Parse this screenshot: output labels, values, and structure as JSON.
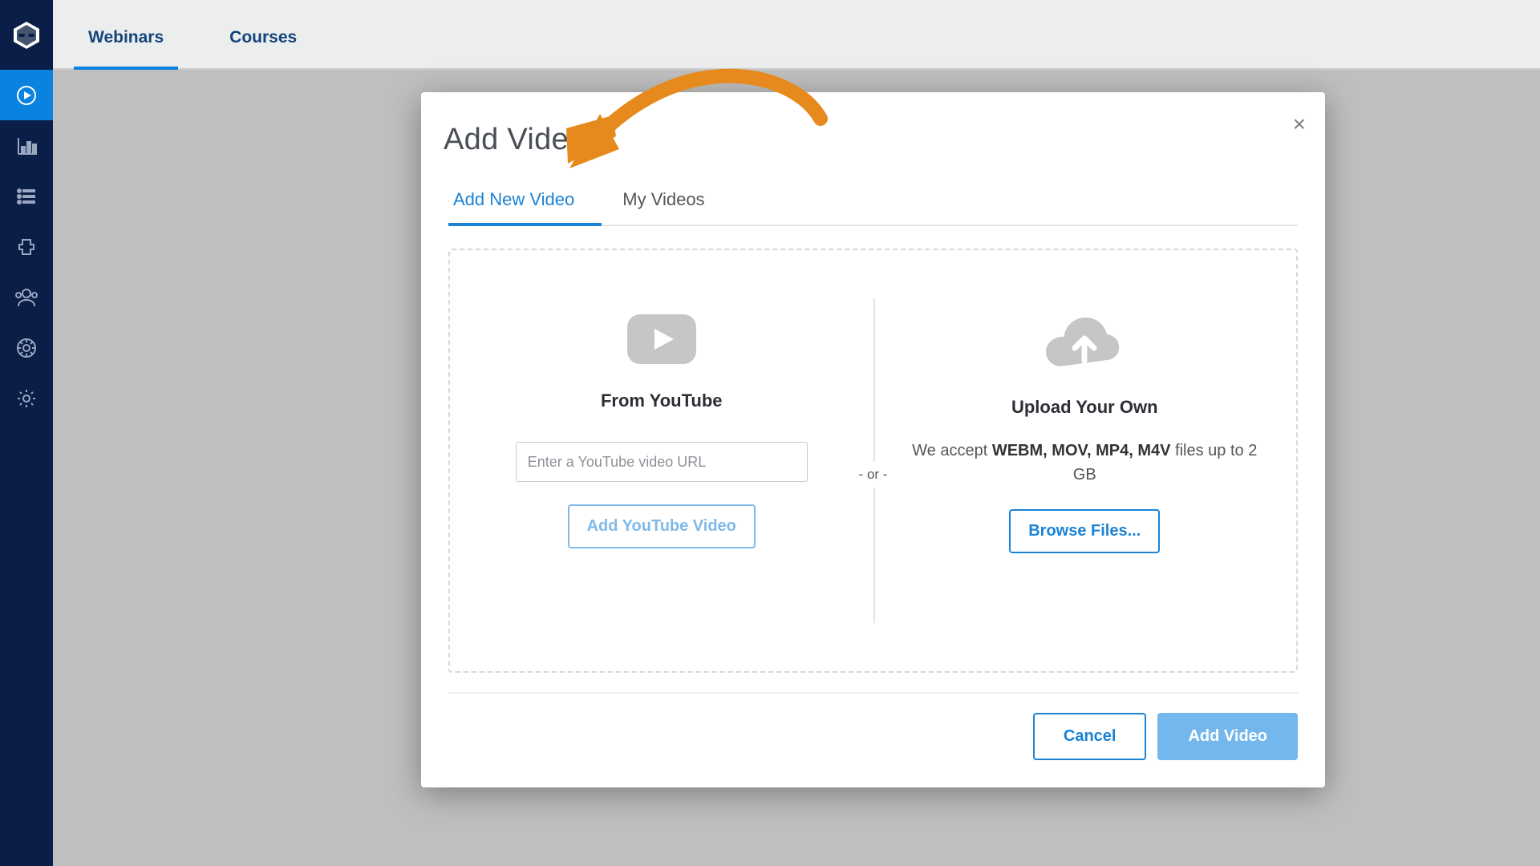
{
  "topnav": {
    "webinars": "Webinars",
    "courses": "Courses"
  },
  "modal": {
    "title": "Add Video",
    "tabs": {
      "add_new": "Add New Video",
      "my_videos": "My Videos"
    },
    "or_label": "- or -",
    "youtube": {
      "title": "From YouTube",
      "placeholder": "Enter a YouTube video URL",
      "button": "Add YouTube Video"
    },
    "upload": {
      "title": "Upload Your Own",
      "hint_prefix": "We accept ",
      "hint_formats": "WEBM, MOV, MP4, M4V",
      "hint_suffix": " files up to 2 GB",
      "browse": "Browse Files..."
    },
    "footer": {
      "cancel": "Cancel",
      "add": "Add Video"
    }
  }
}
